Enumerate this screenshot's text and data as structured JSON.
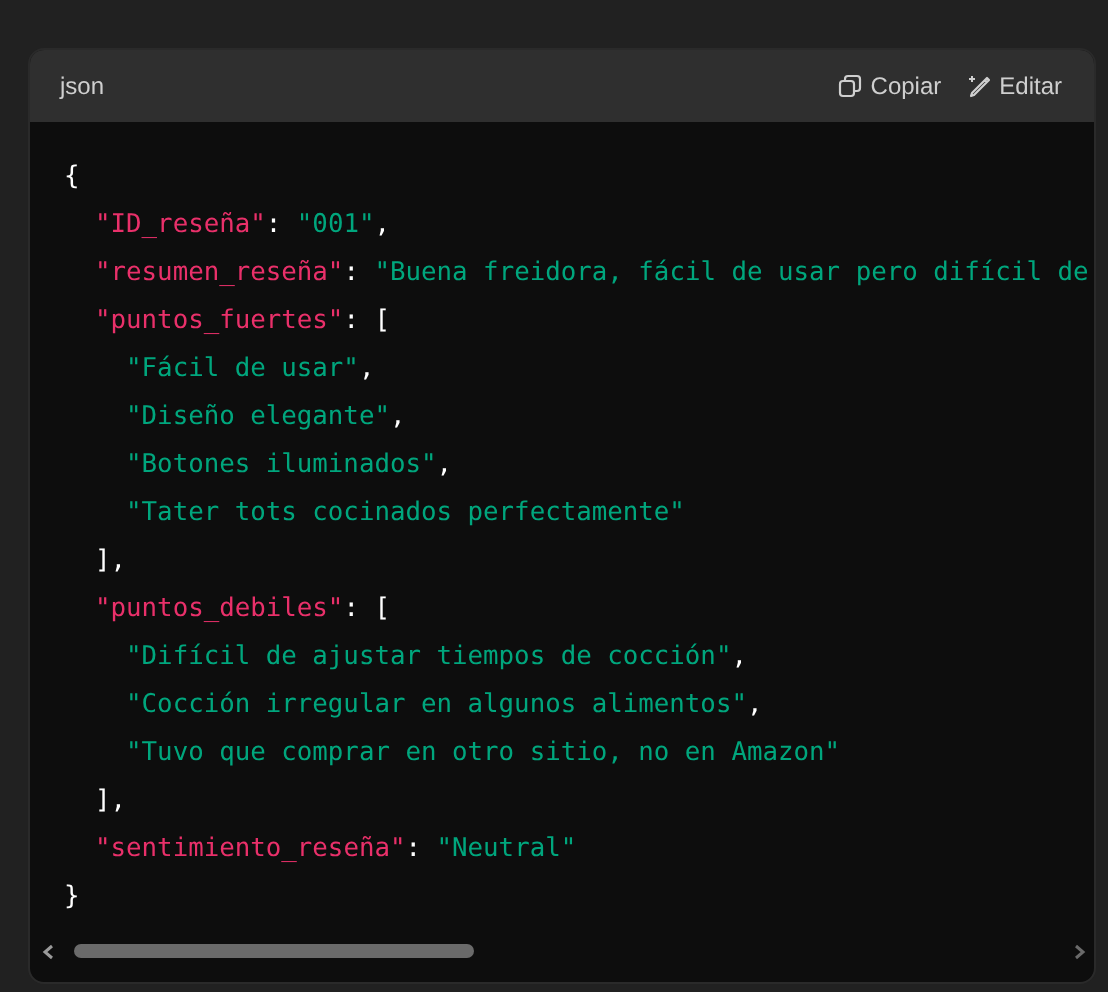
{
  "code_block": {
    "language": "json",
    "actions": [
      {
        "kind": "copy",
        "label": "Copiar"
      },
      {
        "kind": "edit",
        "label": "Editar"
      }
    ],
    "lines": [
      {
        "tokens": [
          {
            "kind": "punct",
            "text": "{"
          }
        ],
        "children": [
          {
            "tokens": [
              {
                "kind": "key",
                "text": "\"ID_reseña\""
              },
              {
                "kind": "punct",
                "text": ": "
              },
              {
                "kind": "string",
                "text": "\"001\""
              },
              {
                "kind": "punct",
                "text": ","
              }
            ]
          },
          {
            "tokens": [
              {
                "kind": "key",
                "text": "\"resumen_reseña\""
              },
              {
                "kind": "punct",
                "text": ": "
              },
              {
                "kind": "string",
                "text": "\"Buena freidora, fácil de usar pero difícil de"
              }
            ]
          },
          {
            "tokens": [
              {
                "kind": "key",
                "text": "\"puntos_fuertes\""
              },
              {
                "kind": "punct",
                "text": ": ["
              }
            ],
            "children": [
              {
                "tokens": [
                  {
                    "kind": "string",
                    "text": "\"Fácil de usar\""
                  },
                  {
                    "kind": "punct",
                    "text": ","
                  }
                ]
              },
              {
                "tokens": [
                  {
                    "kind": "string",
                    "text": "\"Diseño elegante\""
                  },
                  {
                    "kind": "punct",
                    "text": ","
                  }
                ]
              },
              {
                "tokens": [
                  {
                    "kind": "string",
                    "text": "\"Botones iluminados\""
                  },
                  {
                    "kind": "punct",
                    "text": ","
                  }
                ]
              },
              {
                "tokens": [
                  {
                    "kind": "string",
                    "text": "\"Tater tots cocinados perfectamente\""
                  }
                ]
              }
            ]
          },
          {
            "tokens": [
              {
                "kind": "punct",
                "text": "],"
              }
            ]
          },
          {
            "tokens": [
              {
                "kind": "key",
                "text": "\"puntos_debiles\""
              },
              {
                "kind": "punct",
                "text": ": ["
              }
            ],
            "children": [
              {
                "tokens": [
                  {
                    "kind": "string",
                    "text": "\"Difícil de ajustar tiempos de cocción\""
                  },
                  {
                    "kind": "punct",
                    "text": ","
                  }
                ]
              },
              {
                "tokens": [
                  {
                    "kind": "string",
                    "text": "\"Cocción irregular en algunos alimentos\""
                  },
                  {
                    "kind": "punct",
                    "text": ","
                  }
                ]
              },
              {
                "tokens": [
                  {
                    "kind": "string",
                    "text": "\"Tuvo que comprar en otro sitio, no en Amazon\""
                  }
                ]
              }
            ]
          },
          {
            "tokens": [
              {
                "kind": "punct",
                "text": "],"
              }
            ]
          },
          {
            "tokens": [
              {
                "kind": "key",
                "text": "\"sentimiento_reseña\""
              },
              {
                "kind": "punct",
                "text": ": "
              },
              {
                "kind": "string",
                "text": "\"Neutral\""
              }
            ]
          }
        ]
      },
      {
        "tokens": [
          {
            "kind": "punct",
            "text": "}"
          }
        ]
      }
    ]
  }
}
